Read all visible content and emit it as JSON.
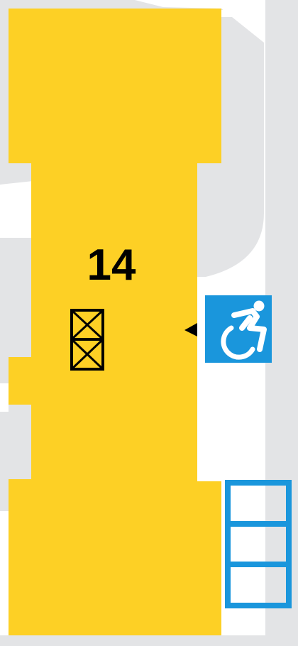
{
  "map": {
    "building": {
      "number": "14",
      "color": "#fdd025"
    },
    "background_color": "#e3e4e6",
    "features": {
      "elevator": {
        "icon": "elevator-icon",
        "color": "#000000"
      },
      "accessible_entrance": {
        "icon": "wheelchair-accessible-icon",
        "color": "#1a96dc"
      },
      "entrance_marker": {
        "icon": "entrance-arrow-icon",
        "color": "#000000"
      },
      "bike_rack": {
        "icon": "bike-rack-icon",
        "color": "#1a96dc"
      }
    }
  }
}
